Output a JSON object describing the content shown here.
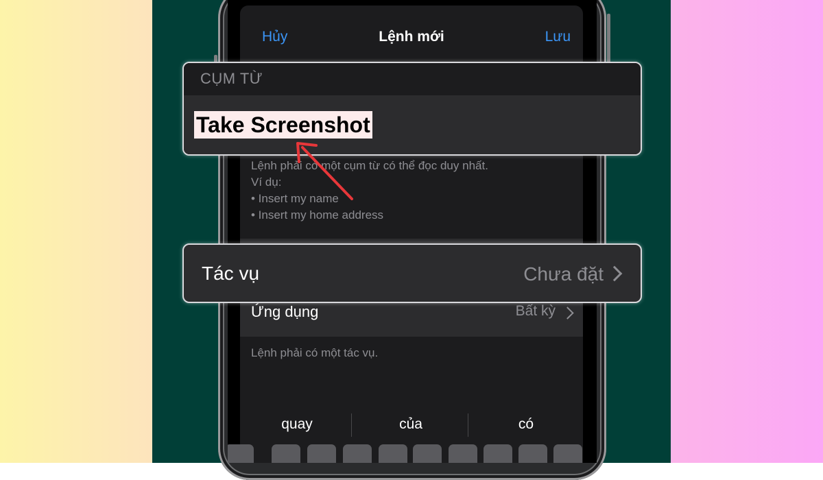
{
  "nav": {
    "cancel": "Hủy",
    "title": "Lệnh mới",
    "save": "Lưu"
  },
  "phrase_section": {
    "header": "CỤM TỪ",
    "value": "Take Screenshot"
  },
  "phrase_footer": [
    "Lệnh phải có một cụm từ có thể đọc duy nhất.",
    "Ví dụ:",
    "• Insert my name",
    "• Insert my home address"
  ],
  "action_row": {
    "label": "Tác vụ",
    "value": "Chưa đặt"
  },
  "app_row": {
    "label": "Ứng dụng",
    "value": "Bất kỳ"
  },
  "action_footer": "Lệnh phải có một tác vụ.",
  "suggestions": [
    "quay",
    "của",
    "có"
  ],
  "colors": {
    "accent": "#3b95f6",
    "highlight": "#fdecec",
    "arrow": "#e8373a"
  }
}
